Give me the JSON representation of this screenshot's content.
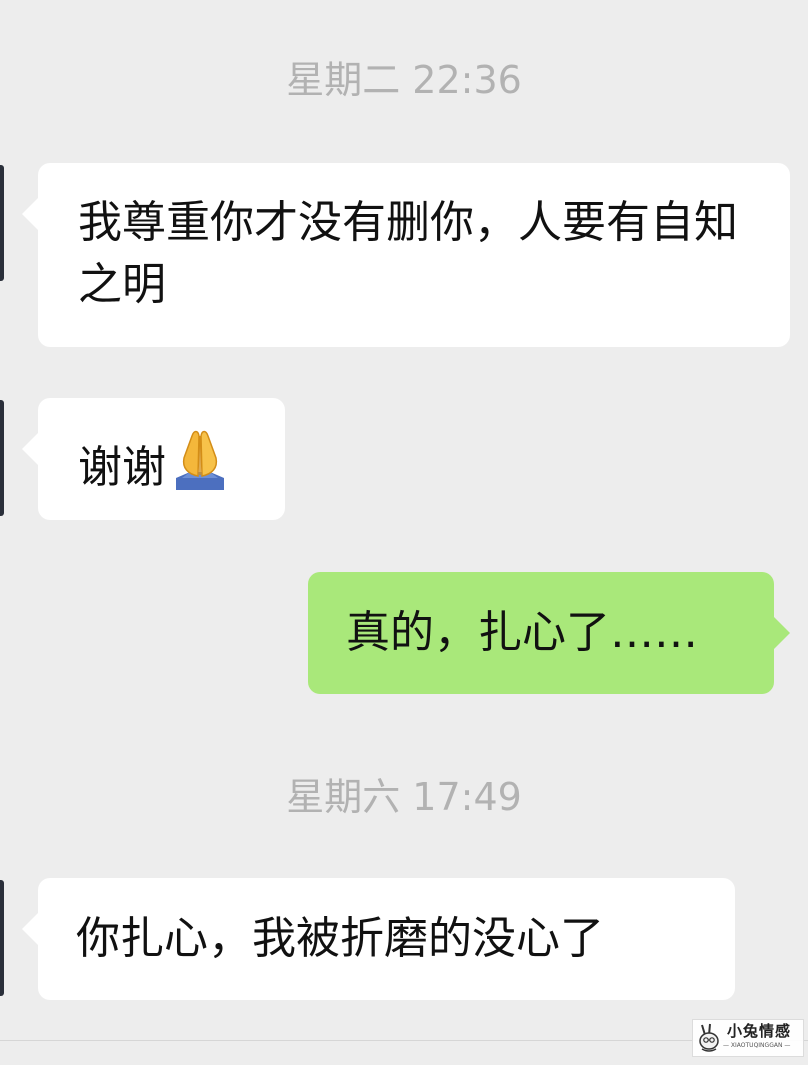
{
  "conversation": {
    "timestamps": [
      "星期二 22:36",
      "星期六 17:49"
    ],
    "messages": [
      {
        "direction": "incoming",
        "text": "我尊重你才没有删你，人要有自知之明"
      },
      {
        "direction": "incoming",
        "text": "谢谢",
        "emoji": "folded-hands-emoji"
      },
      {
        "direction": "outgoing",
        "text": "真的，扎心了……"
      },
      {
        "direction": "incoming",
        "text": "你扎心，我被折磨的没心了"
      }
    ]
  },
  "watermark": {
    "title": "小兔情感",
    "subtitle": "— XIAOTUQINGGAN —"
  },
  "colors": {
    "background": "#ededed",
    "incoming_bubble": "#ffffff",
    "outgoing_bubble": "#a9e87a",
    "timestamp_text": "#b2b2b2",
    "message_text": "#111111"
  }
}
